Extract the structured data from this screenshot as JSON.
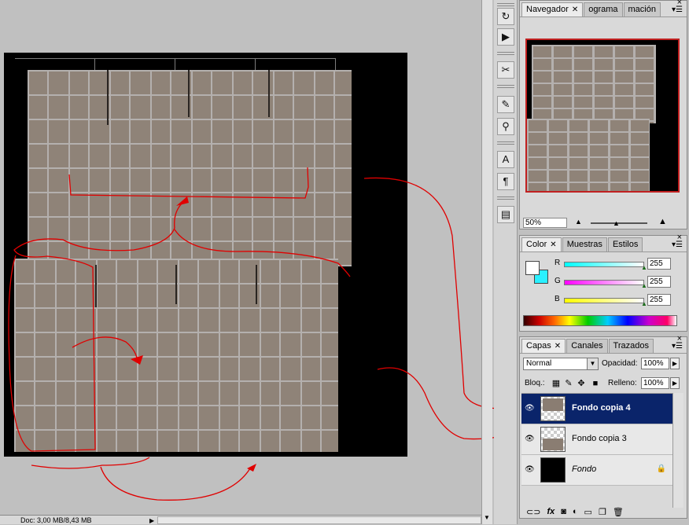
{
  "status": {
    "doc_info": "Doc: 3,00 MB/8,43 MB"
  },
  "navigator": {
    "tabs": [
      {
        "label": "Navegador",
        "active": true
      },
      {
        "label": "ograma",
        "active": false
      },
      {
        "label": "mación",
        "active": false
      }
    ],
    "zoom": "50%"
  },
  "color": {
    "tabs": [
      {
        "label": "Color",
        "active": true
      },
      {
        "label": "Muestras",
        "active": false
      },
      {
        "label": "Estilos",
        "active": false
      }
    ],
    "channels": [
      {
        "label": "R",
        "value": "255",
        "gradient": "linear-gradient(90deg,#00ffff,#ffffff)"
      },
      {
        "label": "G",
        "value": "255",
        "gradient": "linear-gradient(90deg,#ff00ff,#ffffff)"
      },
      {
        "label": "B",
        "value": "255",
        "gradient": "linear-gradient(90deg,#ffff00,#ffffff)"
      }
    ],
    "foreground": "#ffffff",
    "background": "#2af0ff"
  },
  "layers": {
    "tabs": [
      {
        "label": "Capas",
        "active": true
      },
      {
        "label": "Canales",
        "active": false
      },
      {
        "label": "Trazados",
        "active": false
      }
    ],
    "blend_mode": "Normal",
    "opacity_label": "Opacidad:",
    "opacity": "100%",
    "lock_label": "Bloq.:",
    "fill_label": "Relleno:",
    "fill": "100%",
    "items": [
      {
        "name": "Fondo copia 4",
        "selected": true
      },
      {
        "name": "Fondo copia 3",
        "selected": false
      },
      {
        "name": "Fondo",
        "selected": false,
        "locked": true
      }
    ]
  },
  "icons": {
    "tools": [
      "history-icon",
      "actions-icon",
      "tool-presets-icon",
      "brushes-icon",
      "clone-source-icon",
      "character-icon",
      "paragraph-icon",
      "layer-comps-icon"
    ],
    "layer_footer": [
      "link-icon",
      "fx-icon",
      "mask-icon",
      "adjustment-icon",
      "group-icon",
      "new-layer-icon",
      "trash-icon"
    ]
  }
}
